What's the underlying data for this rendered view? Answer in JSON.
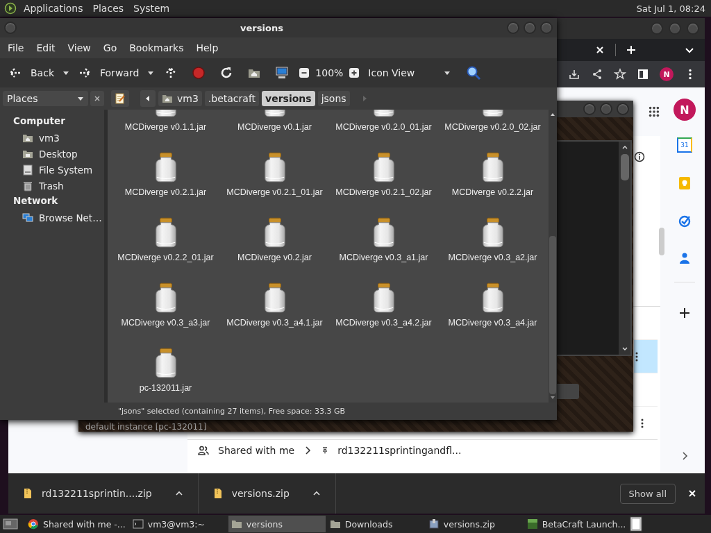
{
  "top_panel": {
    "menus": [
      "Applications",
      "Places",
      "System"
    ],
    "clock": "Sat Jul 1, 08:24"
  },
  "browser": {
    "toolbar_avatar": "N",
    "panel_avatar": "N",
    "calendar_day": "31",
    "breadcrumb": [
      "Shared with me",
      "rd132211sprintingandfl..."
    ],
    "downloads": [
      {
        "name": "rd132211sprintin....zip"
      },
      {
        "name": "versions.zip"
      }
    ],
    "show_all": "Show all"
  },
  "launcher": {
    "instance": "default instance [pc-132011]"
  },
  "file_manager": {
    "title": "versions",
    "menu": [
      "File",
      "Edit",
      "View",
      "Go",
      "Bookmarks",
      "Help"
    ],
    "toolbar": {
      "back": "Back",
      "forward": "Forward",
      "zoom": "100%",
      "view": "Icon View"
    },
    "sidebar": {
      "header": "Places",
      "sections": [
        {
          "heading": "Computer",
          "items": [
            {
              "label": "vm3",
              "kind": "home"
            },
            {
              "label": "Desktop",
              "kind": "folder"
            },
            {
              "label": "File System",
              "kind": "drive"
            },
            {
              "label": "Trash",
              "kind": "trash"
            }
          ]
        },
        {
          "heading": "Network",
          "items": [
            {
              "label": "Browse Net…",
              "kind": "network"
            }
          ]
        }
      ]
    },
    "path": [
      {
        "label": "vm3",
        "kind": "home",
        "selected": false
      },
      {
        "label": ".betacraft",
        "kind": "plain",
        "selected": false
      },
      {
        "label": "versions",
        "kind": "plain",
        "selected": true
      },
      {
        "label": "jsons",
        "kind": "plain",
        "selected": false
      }
    ],
    "files": [
      "MCDiverge v0.1.1.jar",
      "MCDiverge v0.1.jar",
      "MCDiverge v0.2.0_01.jar",
      "MCDiverge v0.2.0_02.jar",
      "MCDiverge v0.2.1.jar",
      "MCDiverge v0.2.1_01.jar",
      "MCDiverge v0.2.1_02.jar",
      "MCDiverge v0.2.2.jar",
      "MCDiverge v0.2.2_01.jar",
      "MCDiverge v0.2.jar",
      "MCDiverge v0.3_a1.jar",
      "MCDiverge v0.3_a2.jar",
      "MCDiverge v0.3_a3.jar",
      "MCDiverge v0.3_a4.1.jar",
      "MCDiverge v0.3_a4.2.jar",
      "MCDiverge v0.3_a4.jar",
      "pc-132011.jar"
    ],
    "status": "\"jsons\" selected (containing 27 items), Free space: 33.3 GB"
  },
  "taskbar": [
    {
      "label": "Shared with me -...",
      "kind": "browser",
      "selected": false
    },
    {
      "label": "vm3@vm3:~",
      "kind": "terminal",
      "selected": false
    },
    {
      "label": "versions",
      "kind": "folder",
      "selected": true
    },
    {
      "label": "Downloads",
      "kind": "folder",
      "selected": false
    },
    {
      "label": "versions.zip",
      "kind": "archive",
      "selected": false
    },
    {
      "label": "BetaCraft Launch...",
      "kind": "app",
      "selected": false
    }
  ]
}
